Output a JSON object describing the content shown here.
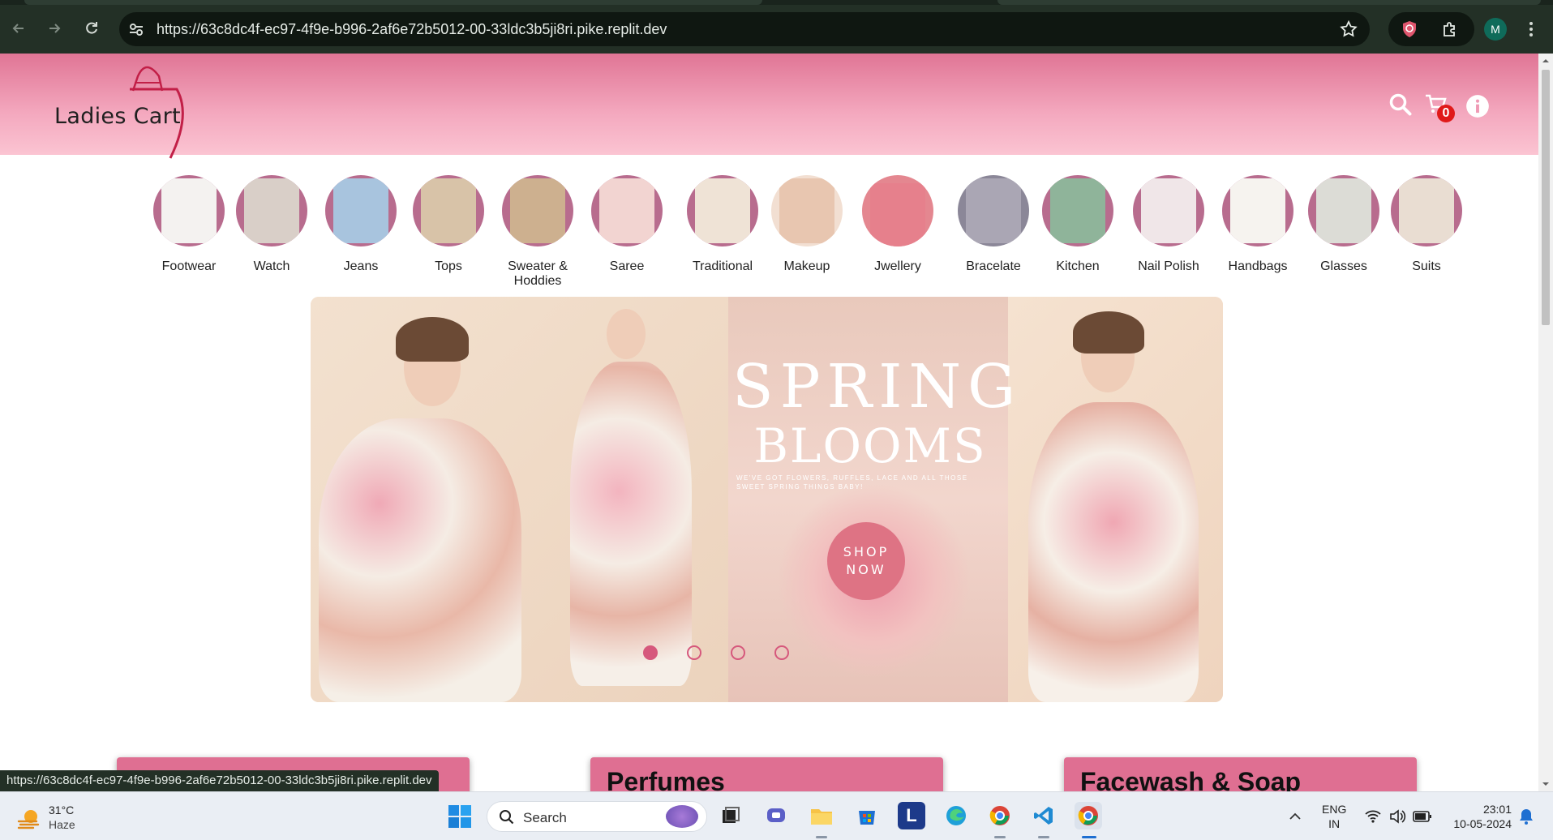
{
  "browser": {
    "url": "https://63c8dc4f-ec97-4f9e-b996-2af6e72b5012-00-33ldc3b5ji8ri.pike.replit.dev",
    "status_url": "https://63c8dc4f-ec97-4f9e-b996-2af6e72b5012-00-33ldc3b5ji8ri.pike.replit.dev",
    "profile_initial": "M"
  },
  "site": {
    "logo_text": "Ladies Cart",
    "cart_count": "0",
    "colors": {
      "header_top": "#e07595",
      "header_bottom": "#fbc4d2",
      "accent": "#d6587c",
      "card": "#df6f92"
    }
  },
  "categories": [
    {
      "label": "Footwear"
    },
    {
      "label": "Watch"
    },
    {
      "label": "Jeans"
    },
    {
      "label": "Tops"
    },
    {
      "label": "Sweater & Hoddies"
    },
    {
      "label": "Saree"
    },
    {
      "label": "Traditional"
    },
    {
      "label": "Makeup"
    },
    {
      "label": "Jwellery"
    },
    {
      "label": "Bracelate"
    },
    {
      "label": "Kitchen"
    },
    {
      "label": "Nail Polish"
    },
    {
      "label": "Handbags"
    },
    {
      "label": "Glasses"
    },
    {
      "label": "Suits"
    }
  ],
  "banner": {
    "headline1": "SPRING",
    "headline2": "BLOOMS",
    "tagline": "WE'VE GOT FLOWERS, RUFFLES, LACE AND ALL THOSE SWEET SPRING THINGS BABY!",
    "cta_line1": "SHOP",
    "cta_line2": "NOW",
    "slide_count": 4,
    "active_slide": 1
  },
  "sections": [
    {
      "title": ""
    },
    {
      "title": "Perfumes"
    },
    {
      "title": "Facewash & Soap"
    }
  ],
  "taskbar": {
    "temperature": "31°C",
    "condition": "Haze",
    "search_label": "Search",
    "lang_line1": "ENG",
    "lang_line2": "IN",
    "time": "23:01",
    "date": "10-05-2024"
  }
}
